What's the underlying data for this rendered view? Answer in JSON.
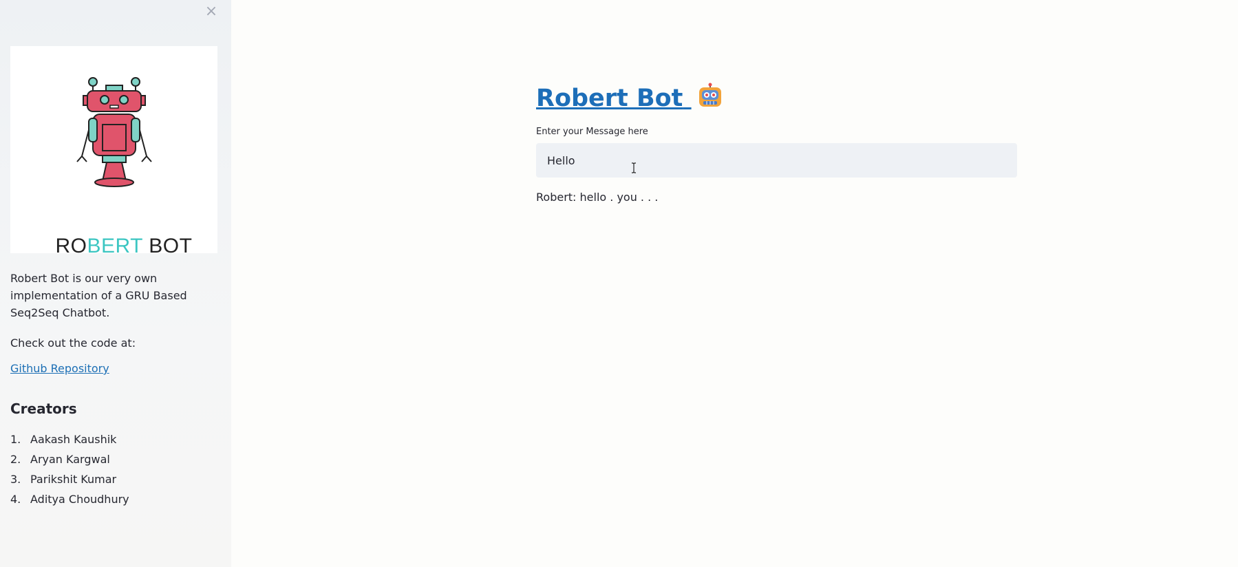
{
  "sidebar": {
    "close_icon": "close-icon",
    "logo": {
      "text_part1": "RO",
      "text_accent": "BERT",
      "text_part2": " BOT",
      "accent_color": "#3cc6c2",
      "robot_color": "#e0546b",
      "robot_teal": "#7fd3c6"
    },
    "description": "Robert Bot is our very own implementation of a GRU Based Seq2Seq Chatbot.",
    "code_prompt": "Check out the code at:",
    "repo_link": "Github Repository",
    "creators_heading": "Creators",
    "creators": [
      {
        "num": "1.",
        "name": "Aakash Kaushik"
      },
      {
        "num": "2.",
        "name": "Aryan Kargwal"
      },
      {
        "num": "3.",
        "name": "Parikshit Kumar"
      },
      {
        "num": "4.",
        "name": "Aditya Choudhury"
      }
    ]
  },
  "main": {
    "title": "Robert Bot",
    "title_icon": "robot-emoji-icon",
    "input_label": "Enter your Message here",
    "input_value": "Hello",
    "reply": "Robert: hello . you . . ."
  },
  "colors": {
    "link": "#1d6eb8",
    "sidebar_bg": "#eef1f4",
    "input_bg": "#eef1f5"
  }
}
